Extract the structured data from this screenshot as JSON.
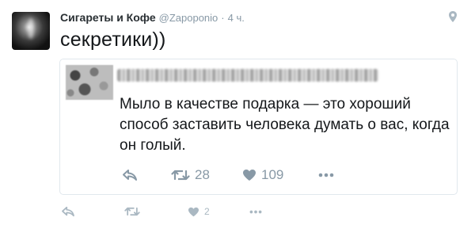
{
  "tweet": {
    "author_name": "Сигареты и Кофе",
    "author_handle": "@Zapoponio",
    "separator": "·",
    "time": "4 ч.",
    "text": "секретики))"
  },
  "quoted": {
    "text": "Мыло в качестве подарка — это хороший способ заставить человека думать о вас, когда он голый.",
    "retweet_count": "28",
    "like_count": "109"
  },
  "actions": {
    "like_count": "2"
  },
  "icons": {
    "pin": "location-pin-icon",
    "reply": "reply-icon",
    "retweet": "retweet-icon",
    "like": "heart-icon",
    "more": "more-icon"
  },
  "colors": {
    "icon_grey": "#aab8c2",
    "quote_icon_grey": "#8899a6",
    "text": "#14171a",
    "border": "#e1e8ed"
  }
}
